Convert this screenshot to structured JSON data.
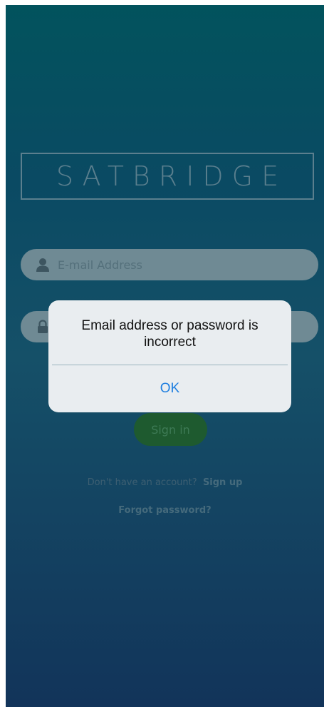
{
  "app": {
    "logo_text": "SATBRIDGE"
  },
  "form": {
    "email_placeholder": "E-mail Address",
    "password_placeholder": "",
    "signin_label": "Sign in",
    "signup_prompt": "Don't have an account?",
    "signup_link": "Sign up",
    "forgot_link": "Forgot password?"
  },
  "dialog": {
    "message": "Email address or password is incorrect",
    "ok_label": "OK"
  },
  "icons": {
    "email": "person-icon",
    "password": "lock-icon"
  },
  "colors": {
    "dialog_button": "#1f7fe0",
    "signin_button": "#1e5a2f"
  }
}
